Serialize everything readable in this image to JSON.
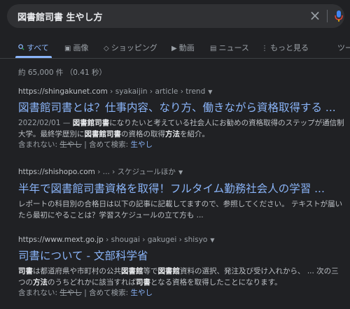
{
  "search": {
    "query": "図書館司書 生やし方",
    "clear_glyph": "×",
    "mic_icon": "mic-icon"
  },
  "tabs": [
    {
      "label": "すべて",
      "icon": "search-icon",
      "glyph": "🔍"
    },
    {
      "label": "画像",
      "icon": "image-icon",
      "glyph": "▣"
    },
    {
      "label": "ショッピング",
      "icon": "tag-icon",
      "glyph": "◇"
    },
    {
      "label": "動画",
      "icon": "video-icon",
      "glyph": "▶"
    },
    {
      "label": "ニュース",
      "icon": "news-icon",
      "glyph": "▤"
    },
    {
      "label": "もっと見る",
      "icon": "more-icon",
      "glyph": "⋮"
    },
    {
      "label": "ツール"
    }
  ],
  "stats": "約 65,000 件 （0.41 秒）",
  "results": [
    {
      "domain": "https://shingakunet.com",
      "path": " › syakaijin › article › trend",
      "title": "図書館司書とは？仕事内容、なり方、働きながら資格取得する ...",
      "date": "2022/02/01 — ",
      "snippet_parts": [
        "図書館司書",
        "になりたいと考えている社会人にお勧めの資格取得のステップが通信制大学。最終学歴別に",
        "図書館司書",
        "の資格の取得",
        "方法",
        "を紹介。"
      ],
      "missing_label": "含まれない: ",
      "missing_term": "生やし",
      "include_label": " | 含めて検索: ",
      "include_term": "生やし"
    },
    {
      "domain": "https://shishopo.com",
      "path": " › ... › スケジュールほか",
      "title": "半年で図書館司書資格を取得！フルタイム勤務社会人の学習 ...",
      "snippet": "レポートの科目別の合格日は以下の記事に記載してますので、参照してください。 テキストが届いたら最初にやることは？学習スケジュールの立て方も ..."
    },
    {
      "domain": "https://www.mext.go.jp",
      "path": " › shougai › gakugei › shisyo",
      "title": "司書について - 文部科学省",
      "snippet_parts": [
        "司書",
        "は都道府県や市町村の公共",
        "図書館",
        "等で",
        "図書館",
        "資料の選択、発注及び受け入れから、 ... 次の三つの",
        "方法",
        "のうちどれかに該当すれば",
        "司書",
        "となる資格を取得したことになります。"
      ],
      "missing_label": "含まれない: ",
      "missing_term": "生やし",
      "include_label": " | 含めて検索: ",
      "include_term": "生やし"
    }
  ],
  "colors": {
    "background": "#202124",
    "link": "#8ab4f8",
    "text": "#bdc1c6",
    "muted": "#9aa0a6"
  }
}
